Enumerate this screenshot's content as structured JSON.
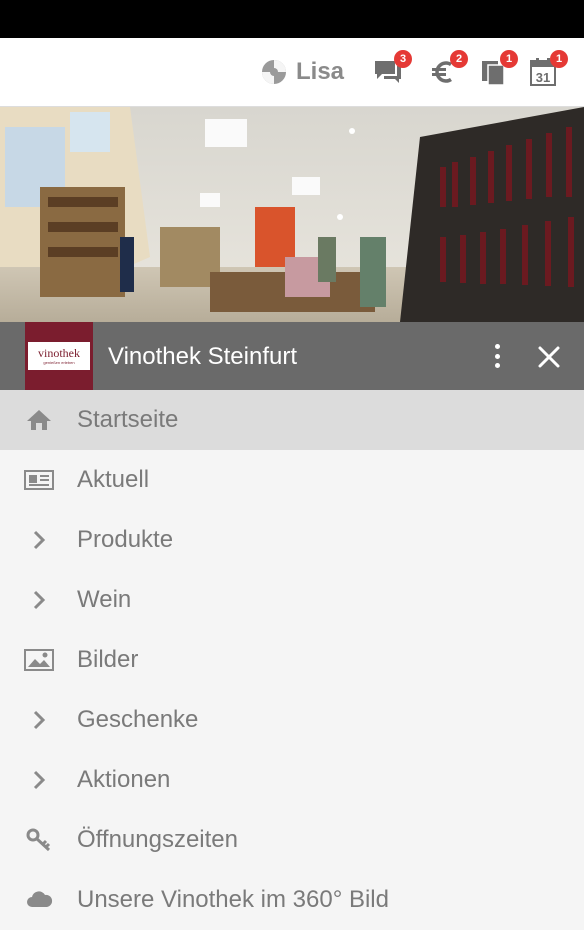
{
  "header": {
    "brand_icon": "logo-swirl-icon",
    "brand_name": "Lisa",
    "icons": [
      {
        "name": "chat-icon",
        "badge": "3"
      },
      {
        "name": "euro-icon",
        "badge": "2"
      },
      {
        "name": "documents-icon",
        "badge": "1"
      },
      {
        "name": "calendar-icon",
        "badge": "1",
        "date": "31"
      }
    ]
  },
  "store": {
    "logo_word": "vinothek",
    "logo_tagline": "genießen erleben",
    "title": "Vinothek Steinfurt"
  },
  "menu": {
    "items": [
      {
        "label": "Startseite",
        "icon": "home-icon",
        "active": true
      },
      {
        "label": "Aktuell",
        "icon": "newspaper-icon"
      },
      {
        "label": "Produkte",
        "icon": "chevron-right-icon"
      },
      {
        "label": "Wein",
        "icon": "chevron-right-icon"
      },
      {
        "label": "Bilder",
        "icon": "image-icon"
      },
      {
        "label": "Geschenke",
        "icon": "chevron-right-icon"
      },
      {
        "label": "Aktionen",
        "icon": "chevron-right-icon"
      },
      {
        "label": "Öffnungszeiten",
        "icon": "key-icon"
      },
      {
        "label": "Unsere Vinothek im 360° Bild",
        "icon": "cloud-icon"
      }
    ]
  },
  "colors": {
    "accent": "#7b1d2e",
    "badge": "#e53935",
    "titlebar": "#6a6a6a",
    "active_row": "#dcdcdc",
    "menu_text": "#7a7a7a"
  }
}
